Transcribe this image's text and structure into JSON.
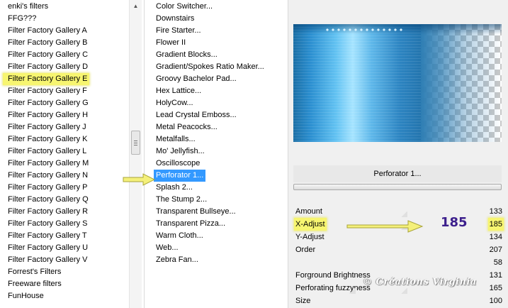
{
  "categories": [
    {
      "label": "enki's filters"
    },
    {
      "label": "FFG???"
    },
    {
      "label": "Filter Factory Gallery A"
    },
    {
      "label": "Filter Factory Gallery B"
    },
    {
      "label": "Filter Factory Gallery C"
    },
    {
      "label": "Filter Factory Gallery D"
    },
    {
      "label": "Filter Factory Gallery E"
    },
    {
      "label": "Filter Factory Gallery F"
    },
    {
      "label": "Filter Factory Gallery G"
    },
    {
      "label": "Filter Factory Gallery H"
    },
    {
      "label": "Filter Factory Gallery J"
    },
    {
      "label": "Filter Factory Gallery K"
    },
    {
      "label": "Filter Factory Gallery L"
    },
    {
      "label": "Filter Factory Gallery M"
    },
    {
      "label": "Filter Factory Gallery N"
    },
    {
      "label": "Filter Factory Gallery P"
    },
    {
      "label": "Filter Factory Gallery Q"
    },
    {
      "label": "Filter Factory Gallery R"
    },
    {
      "label": "Filter Factory Gallery S"
    },
    {
      "label": "Filter Factory Gallery T"
    },
    {
      "label": "Filter Factory Gallery U"
    },
    {
      "label": "Filter Factory Gallery V"
    },
    {
      "label": "Forrest's Filters"
    },
    {
      "label": "Freeware filters"
    },
    {
      "label": "FunHouse"
    }
  ],
  "selected_category": "Filter Factory Gallery E",
  "filters": [
    {
      "label": "Color Switcher..."
    },
    {
      "label": "Downstairs"
    },
    {
      "label": "Fire Starter..."
    },
    {
      "label": "Flower II"
    },
    {
      "label": "Gradient Blocks..."
    },
    {
      "label": "Gradient/Spokes Ratio Maker..."
    },
    {
      "label": "Groovy Bachelor Pad..."
    },
    {
      "label": "Hex Lattice..."
    },
    {
      "label": "HolyCow..."
    },
    {
      "label": "Lead Crystal Emboss..."
    },
    {
      "label": "Metal Peacocks..."
    },
    {
      "label": "Metalfalls..."
    },
    {
      "label": "Mo' Jellyfish..."
    },
    {
      "label": "Oscilloscope"
    },
    {
      "label": "Perforator 1..."
    },
    {
      "label": "Splash 2..."
    },
    {
      "label": "The Stump 2..."
    },
    {
      "label": "Transparent Bullseye..."
    },
    {
      "label": "Transparent Pizza..."
    },
    {
      "label": "Warm Cloth..."
    },
    {
      "label": "Web..."
    },
    {
      "label": "Zebra Fan..."
    }
  ],
  "selected_filter": "Perforator 1...",
  "preset_name": "Perforator 1...",
  "params": [
    {
      "label": "Amount",
      "value": "133"
    },
    {
      "label": "X-Adjust",
      "value": "185"
    },
    {
      "label": "Y-Adjust",
      "value": "134"
    },
    {
      "label": "Order",
      "value": "207"
    },
    {
      "label": "",
      "value": "58"
    },
    {
      "label": "Forground Brightness",
      "value": "131"
    },
    {
      "label": "Perforating fuzzyness",
      "value": "165"
    },
    {
      "label": "Size",
      "value": "100"
    }
  ],
  "annotation_value": "185",
  "watermark": "© Créations Virginia",
  "colors": {
    "highlight_yellow": "#f7f570",
    "selection_blue": "#3399ff",
    "annotation_text": "#3c1f8c",
    "arrow_yellow": "#f4f07a"
  },
  "icons": {
    "scroll_up": "chevron-up-icon",
    "scroll_down": "chevron-down-icon",
    "pointer_arrows": "arrow-right-icon"
  }
}
